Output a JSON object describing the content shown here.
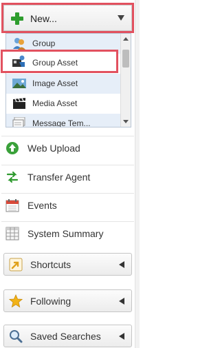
{
  "new_button": {
    "label": "New...",
    "icon": "plus-icon"
  },
  "new_menu": {
    "items": [
      {
        "label": "Group",
        "icon": "group-icon"
      },
      {
        "label": "Group Asset",
        "icon": "group-asset-icon"
      },
      {
        "label": "Image Asset",
        "icon": "image-asset-icon"
      },
      {
        "label": "Media Asset",
        "icon": "media-asset-icon"
      },
      {
        "label": "Message Tem...",
        "icon": "message-template-icon"
      }
    ]
  },
  "nav": {
    "items": [
      {
        "label": "Web Upload",
        "icon": "upload-icon"
      },
      {
        "label": "Transfer Agent",
        "icon": "transfer-icon"
      },
      {
        "label": "Events",
        "icon": "calendar-icon"
      },
      {
        "label": "System Summary",
        "icon": "summary-icon"
      }
    ]
  },
  "sections": {
    "items": [
      {
        "label": "Shortcuts",
        "icon": "shortcut-arrow-icon"
      },
      {
        "label": "Following",
        "icon": "star-icon"
      },
      {
        "label": "Saved Searches",
        "icon": "search-icon"
      }
    ]
  },
  "colors": {
    "highlight_border": "#e2515f",
    "plus_green": "#2e9d2e",
    "menu_hover": "#e6eef8"
  }
}
